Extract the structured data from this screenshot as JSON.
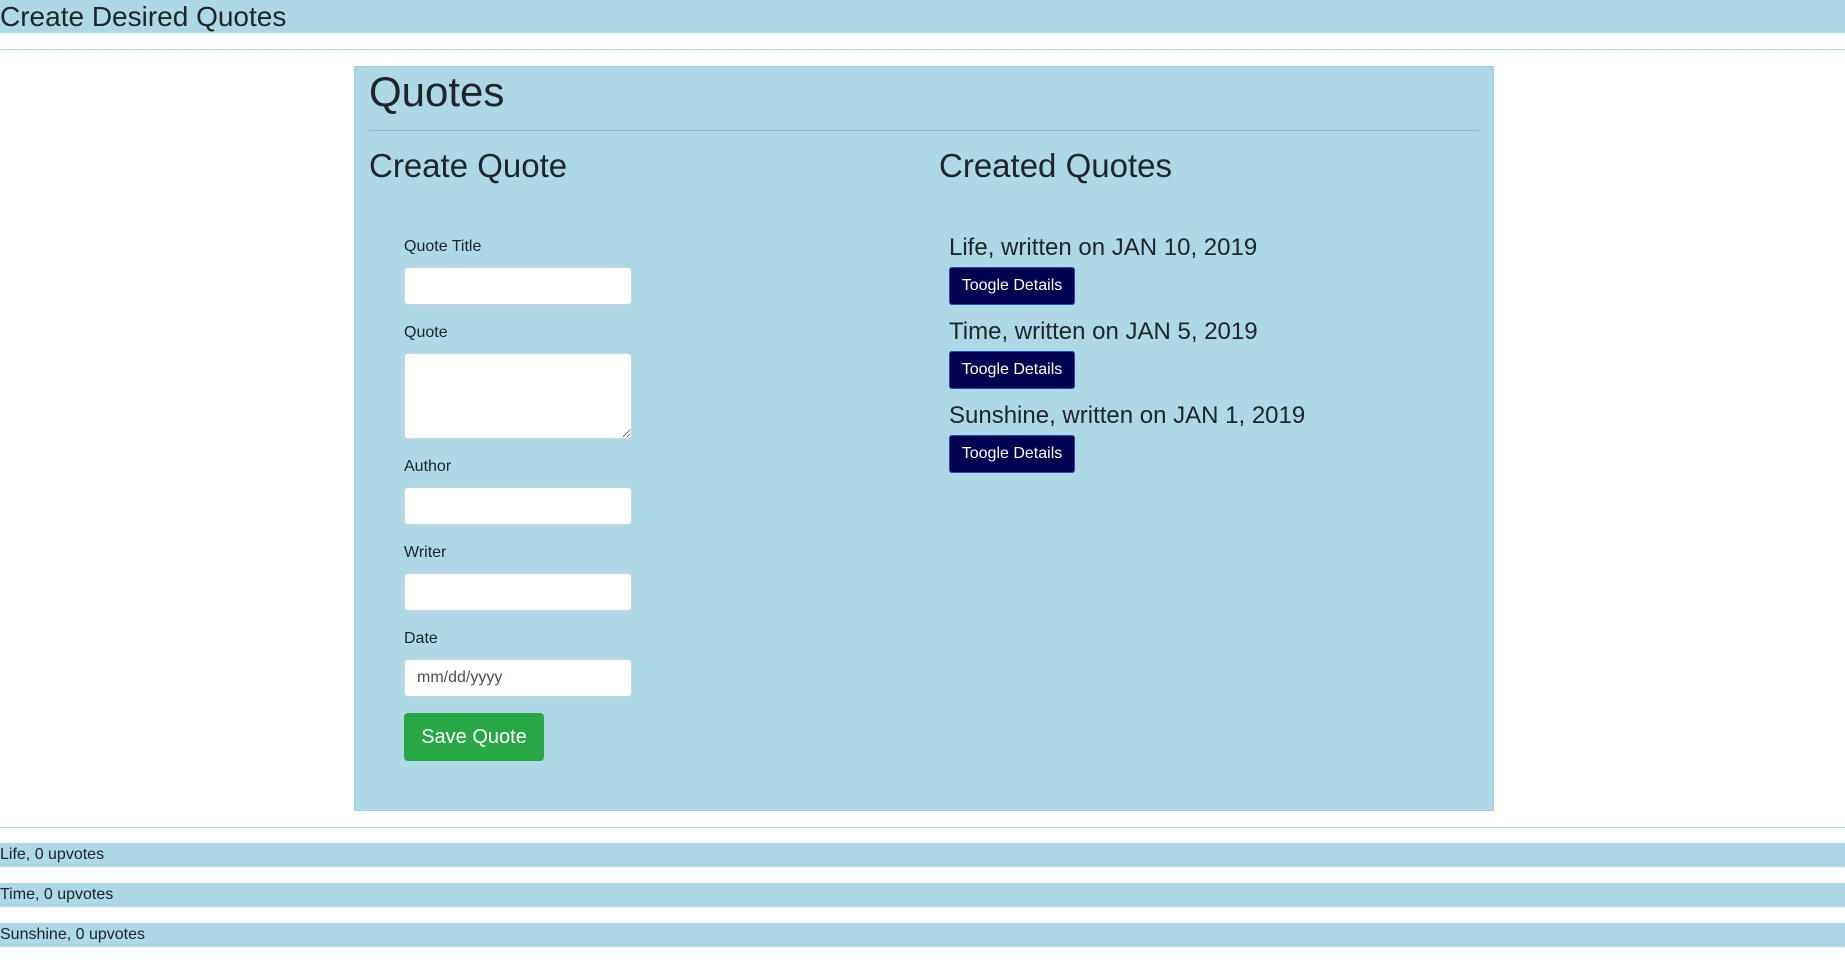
{
  "header": {
    "title": "Create Desired Quotes"
  },
  "panel": {
    "title": "Quotes",
    "create_section_title": "Create Quote",
    "created_section_title": "Created Quotes"
  },
  "form": {
    "title_label": "Quote Title",
    "title_value": "",
    "quote_label": "Quote",
    "quote_value": "",
    "author_label": "Author",
    "author_value": "",
    "writer_label": "Writer",
    "writer_value": "",
    "date_label": "Date",
    "date_placeholder": "mm/dd/yyyy",
    "save_label": "Save Quote"
  },
  "quotes": [
    {
      "heading": "Life, written on JAN 10, 2019",
      "toggle_label": "Toogle Details"
    },
    {
      "heading": "Time, written on JAN 5, 2019",
      "toggle_label": "Toogle Details"
    },
    {
      "heading": "Sunshine, written on JAN 1, 2019",
      "toggle_label": "Toogle Details"
    }
  ],
  "upvotes": [
    {
      "text": "Life, 0 upvotes"
    },
    {
      "text": "Time, 0 upvotes"
    },
    {
      "text": "Sunshine, 0 upvotes"
    }
  ],
  "colors": {
    "light_blue": "#add8e6",
    "toggle_button": "#000050",
    "save_button": "#28a745"
  }
}
